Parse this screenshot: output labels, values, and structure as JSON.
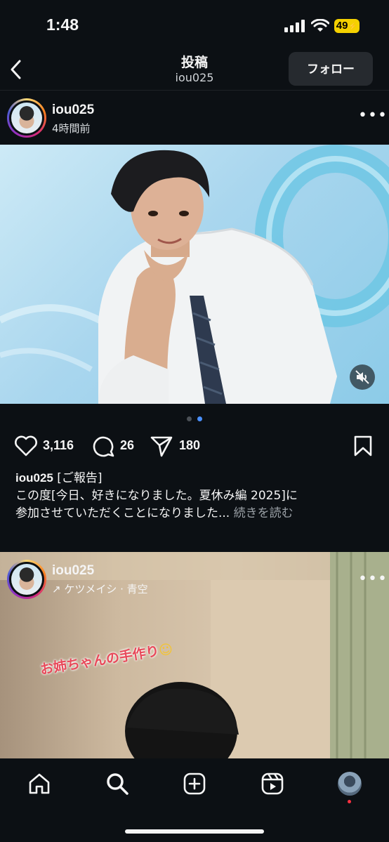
{
  "status_bar": {
    "time": "1:48",
    "battery": "49"
  },
  "header": {
    "title": "投稿",
    "subtitle": "iou025",
    "follow_label": "フォロー"
  },
  "post1": {
    "username": "iou025",
    "time_ago": "4時間前",
    "image_count": 2,
    "active_image_index": 2,
    "likes": "3,116",
    "comments": "26",
    "shares": "180",
    "caption_username": "iou025",
    "caption_first": "[ご報告]",
    "caption_line2": "この度[今日、好きになりました。夏休み編 2025]に",
    "caption_line3": "参加させていただくことになりました...",
    "more_label": "続きを読む"
  },
  "post2": {
    "username": "iou025",
    "music": "ケツメイシ · 青空",
    "sticker_text": "お姉ちゃんの手作り"
  },
  "nav": {
    "items": [
      "home-icon",
      "search-icon",
      "create-icon",
      "reels-icon",
      "profile-avatar"
    ]
  }
}
